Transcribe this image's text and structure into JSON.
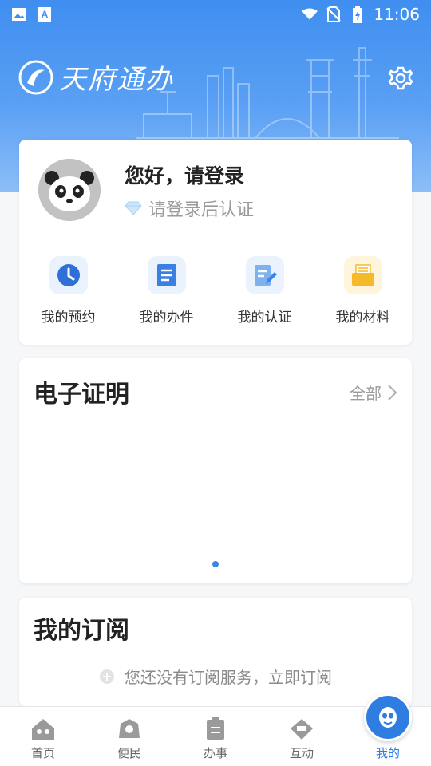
{
  "status_bar": {
    "time": "11:06",
    "icons": [
      "image-icon",
      "text-a-icon",
      "wifi-icon",
      "no-sim-icon",
      "battery-charging-icon"
    ]
  },
  "header": {
    "logo_text": "天府通办",
    "settings_icon": "gear-icon"
  },
  "profile": {
    "greeting": "您好，请登录",
    "cert_hint": "请登录后认证",
    "shortcuts": [
      {
        "label": "我的预约",
        "icon": "clock-icon",
        "color": "#2f6fd6",
        "bg": "#eaf2fd"
      },
      {
        "label": "我的办件",
        "icon": "document-icon",
        "color": "#3b7fe2",
        "bg": "#eaf2fd"
      },
      {
        "label": "我的认证",
        "icon": "certify-edit-icon",
        "color": "#4d8fe8",
        "bg": "#eaf2fd"
      },
      {
        "label": "我的材料",
        "icon": "folder-icon",
        "color": "#f6b929",
        "bg": "#fff4dc"
      }
    ]
  },
  "ecert": {
    "title": "电子证明",
    "see_all": "全部"
  },
  "subscription": {
    "title": "我的订阅",
    "empty_text": "您还没有订阅服务，立即订阅"
  },
  "tabbar": {
    "tabs": [
      {
        "label": "首页",
        "icon": "home-panda-icon"
      },
      {
        "label": "便民",
        "icon": "convenience-icon"
      },
      {
        "label": "办事",
        "icon": "affairs-icon"
      },
      {
        "label": "互动",
        "icon": "interaction-icon"
      },
      {
        "label": "我的",
        "icon": "profile-mask-icon",
        "active": true
      }
    ]
  },
  "colors": {
    "header": "#3f8ef0",
    "accent": "#2f7de1"
  }
}
